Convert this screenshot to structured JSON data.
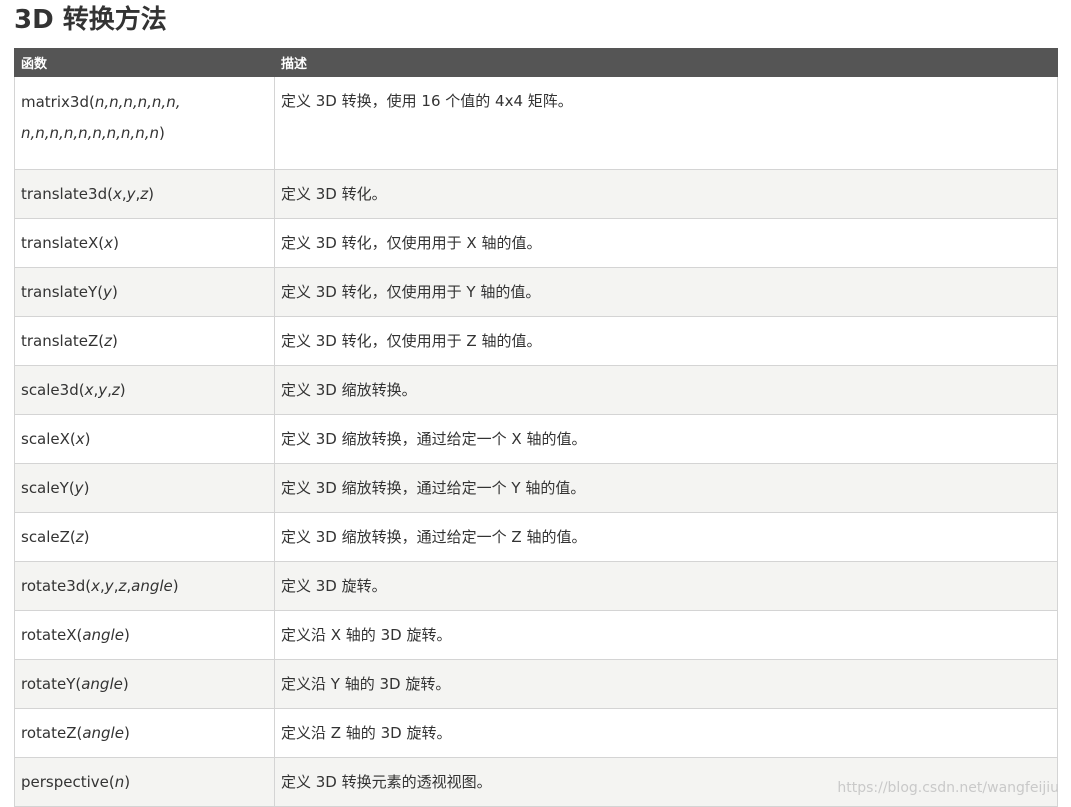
{
  "page": {
    "title": "3D 转换方法"
  },
  "table": {
    "headers": [
      "函数",
      "描述"
    ],
    "rows": [
      {
        "name": "matrix3d(",
        "args": "n,n,n,n,n,n,",
        "args2": "n,n,n,n,n,n,n,n,n,n",
        "close": ")",
        "desc": "定义 3D 转换，使用 16 个值的 4x4 矩阵。"
      },
      {
        "name": "translate3d(",
        "args": "x",
        "sep1": ",",
        "args_b": "y",
        "sep2": ",",
        "args_c": "z",
        "close": ")",
        "desc": "定义 3D 转化。"
      },
      {
        "name": "translateX(",
        "args": "x",
        "close": ")",
        "desc": "定义 3D 转化，仅使用用于 X 轴的值。"
      },
      {
        "name": "translateY(",
        "args": "y",
        "close": ")",
        "desc": "定义 3D 转化，仅使用用于 Y 轴的值。"
      },
      {
        "name": "translateZ(",
        "args": "z",
        "close": ")",
        "desc": "定义 3D 转化，仅使用用于 Z 轴的值。"
      },
      {
        "name": "scale3d(",
        "args": "x",
        "sep1": ",",
        "args_b": "y",
        "sep2": ",",
        "args_c": "z",
        "close": ")",
        "desc": "定义 3D 缩放转换。"
      },
      {
        "name": "scaleX(",
        "args": "x",
        "close": ")",
        "desc": "定义 3D 缩放转换，通过给定一个 X 轴的值。"
      },
      {
        "name": "scaleY(",
        "args": "y",
        "close": ")",
        "desc": "定义 3D 缩放转换，通过给定一个 Y 轴的值。"
      },
      {
        "name": "scaleZ(",
        "args": "z",
        "close": ")",
        "desc": "定义 3D 缩放转换，通过给定一个 Z 轴的值。"
      },
      {
        "name": "rotate3d(",
        "args": "x",
        "sep1": ",",
        "args_b": "y",
        "sep2": ",",
        "args_c": "z",
        "sep3": ",",
        "args_d": "angle",
        "close": ")",
        "desc": "定义 3D 旋转。"
      },
      {
        "name": "rotateX(",
        "args": "angle",
        "close": ")",
        "desc": "定义沿 X 轴的 3D 旋转。"
      },
      {
        "name": "rotateY(",
        "args": "angle",
        "close": ")",
        "desc": "定义沿 Y 轴的 3D 旋转。"
      },
      {
        "name": "rotateZ(",
        "args": "angle",
        "close": ")",
        "desc": "定义沿 Z 轴的 3D 旋转。"
      },
      {
        "name": "perspective(",
        "args": "n",
        "close": ")",
        "desc": "定义 3D 转换元素的透视视图。"
      }
    ]
  },
  "watermark": {
    "text": "https://blog.csdn.net/wangfeijiu"
  }
}
